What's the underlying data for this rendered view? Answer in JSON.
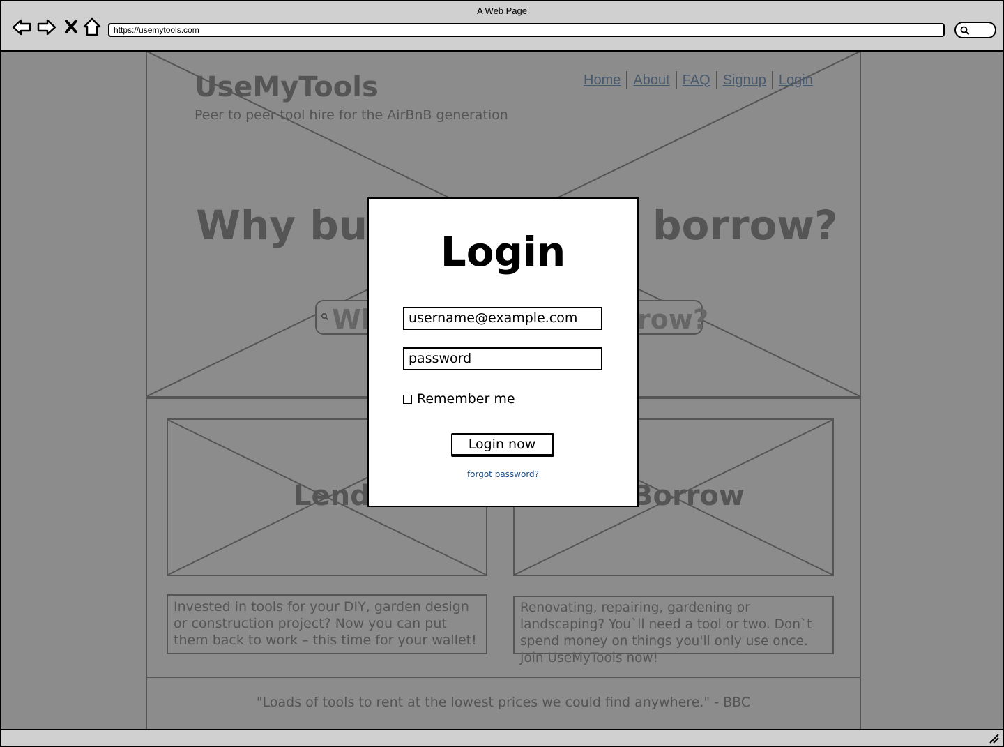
{
  "browser": {
    "title": "A Web Page",
    "url": "https://usemytools.com"
  },
  "site": {
    "logo": "UseMyTools",
    "tagline": "Peer to peer tool hire for the AirBnB generation",
    "nav": [
      "Home",
      "About",
      "FAQ",
      "Signup",
      "Login"
    ]
  },
  "hero": {
    "heading_start": "Why buy",
    "heading_end": "borrow?",
    "search_start": "Wh",
    "search_end": "row?"
  },
  "cards": {
    "lend": {
      "title": "Lend",
      "text": "Invested in tools for your DIY, garden design or construction project? Now you can put them back to work – this time for your wallet!"
    },
    "borrow": {
      "title": "Borrow",
      "text": "Renovating, repairing, gardening or landscaping? You`ll need a tool or two. Don`t spend money on things you'll only use once. Join UseMyTools now!"
    }
  },
  "footer": {
    "quote": "\"Loads of tools to rent at the lowest prices we could find anywhere.\" - BBC"
  },
  "login_modal": {
    "title": "Login",
    "username_value": "username@example.com",
    "password_value": "password",
    "remember_label": "Remember me",
    "remember_checked": false,
    "submit_label": "Login now",
    "forgot_label": "forgot password?"
  },
  "colors": {
    "overlay": "#8c8c8c",
    "dimmed_text": "#555555",
    "link": "#1a4f8a"
  }
}
